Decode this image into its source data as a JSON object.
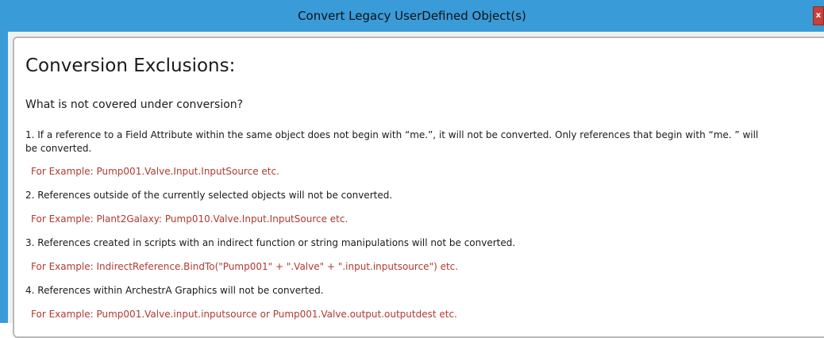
{
  "window": {
    "title": "Convert Legacy UserDefined Object(s)",
    "close_label": "x"
  },
  "content": {
    "heading": "Conversion Exclusions:",
    "question": "What is not covered under conversion?",
    "item1_line1": "1. If a reference to a Field Attribute within the same object does not begin with “me.”, it will not be converted. Only references that begin with “me. ” will",
    "item1_line2": "be converted.",
    "item1_example": "For Example: Pump001.Valve.Input.InputSource etc.",
    "item2": "2. References outside of the currently selected objects will not be converted.",
    "item2_example": "For Example: Plant2Galaxy: Pump010.Valve.Input.InputSource etc.",
    "item3": "3. References created in scripts with an indirect function or string manipulations will not be converted.",
    "item3_example": "For Example: IndirectReference.BindTo(\"Pump001\" + \".Valve\" + \".input.inputsource\") etc.",
    "item4": "4. References within ArchestrA Graphics will not be converted.",
    "item4_example": "For Example: Pump001.Valve.input.inputsource or Pump001.Valve.output.outputdest etc."
  },
  "colors": {
    "titlebar": "#3a9bd9",
    "example_text": "#b03a32",
    "close_button": "#c7403a"
  }
}
